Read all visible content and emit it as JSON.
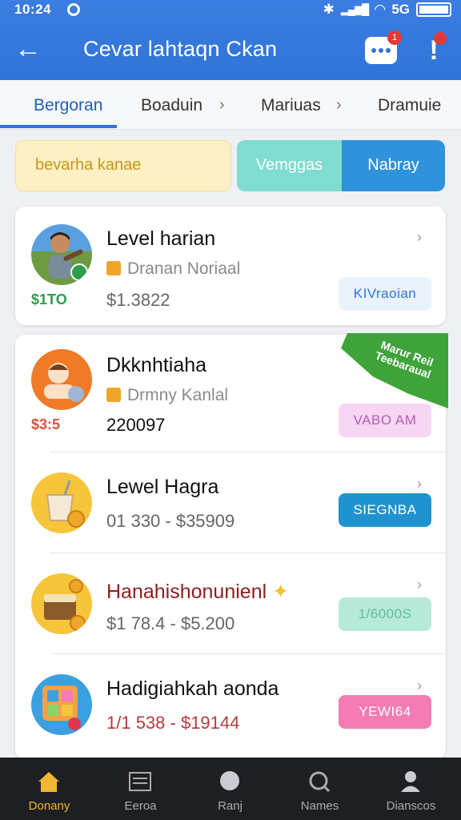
{
  "status_bar": {
    "time": "10:24",
    "network": "5G"
  },
  "app_bar": {
    "title": "Cevar lahtaqn Ckan",
    "chat_badge": "1"
  },
  "tabs": [
    {
      "label": "Bergoran",
      "active": true
    },
    {
      "label": "Boaduin",
      "active": false
    },
    {
      "label": "Mariuas",
      "active": false
    },
    {
      "label": "Dramuie",
      "active": false
    }
  ],
  "filters": {
    "left": "bevarha kanae",
    "seg_a": "Vemggas",
    "seg_b": "Nabray"
  },
  "card1": {
    "title": "Level harian",
    "subtitle": "Dranan Noriaal",
    "chip": "$1TO",
    "price": "$1.3822",
    "pill": "KIVraoian",
    "pill_color": "#eaf3fb",
    "pill_text_color": "#2f74d8"
  },
  "ribbon": {
    "text": "Marur Reil Teebaraual"
  },
  "rows": [
    {
      "title": "Dkknhtiaha",
      "subtitle": "Drmny Kanlal",
      "chip": "$3:5",
      "price": "220097",
      "pill": "VABO AM",
      "pill_bg": "#f7d6f4",
      "pill_fg": "#b75bb0",
      "title_color": "#111111",
      "avatar_icon": "hand-coin-icon"
    },
    {
      "title": "Lewel Hagra",
      "price": "01 330 - $35909",
      "pill": "SIEGNBA",
      "pill_bg": "#1f93cf",
      "pill_fg": "#ffffff",
      "title_color": "#111111",
      "avatar_icon": "cup-icon"
    },
    {
      "title": "Hanahishonunienl",
      "price": "$1 78.4 - $5.200",
      "pill": "1/6000S",
      "pill_bg": "#b7ead9",
      "pill_fg": "#5fbf9c",
      "title_color": "#8b1f1f",
      "avatar_icon": "cake-coin-icon"
    },
    {
      "title": "Hadigiahkah aonda",
      "price": "1/1 538 - $19144",
      "pill": "YEWI64",
      "pill_bg": "#f47bb4",
      "pill_fg": "#ffffff",
      "title_color": "#111111",
      "avatar_icon": "app-tiles-icon"
    }
  ],
  "bottom_nav": [
    {
      "label": "Donany",
      "icon": "home-icon",
      "active": true
    },
    {
      "label": "Eeroa",
      "icon": "list-icon",
      "active": false
    },
    {
      "label": "Ranj",
      "icon": "bubble-icon",
      "active": false
    },
    {
      "label": "Names",
      "icon": "search-icon",
      "active": false
    },
    {
      "label": "Dianscos",
      "icon": "person-icon",
      "active": false
    }
  ]
}
